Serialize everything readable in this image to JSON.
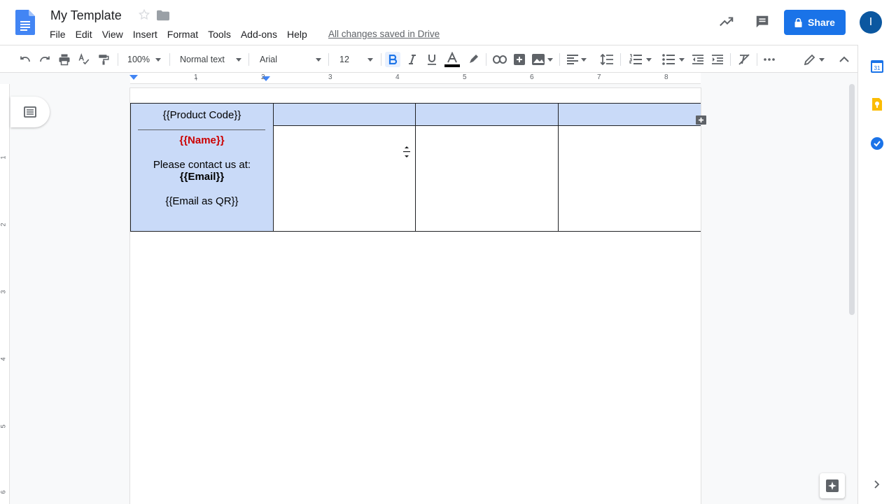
{
  "header": {
    "title": "My Template",
    "menu": [
      "File",
      "Edit",
      "View",
      "Insert",
      "Format",
      "Tools",
      "Add-ons",
      "Help"
    ],
    "save_status": "All changes saved in Drive",
    "share_label": "Share",
    "avatar_initial": "I"
  },
  "toolbar": {
    "zoom": "100%",
    "style": "Normal text",
    "font": "Arial",
    "size": "12"
  },
  "ruler": {
    "h_numbers": [
      "1",
      "2",
      "3",
      "4",
      "5",
      "6",
      "7",
      "8"
    ],
    "v_numbers": [
      "1",
      "2",
      "3",
      "4",
      "5",
      "6"
    ]
  },
  "document": {
    "cell": {
      "product_code": "{{Product Code}}",
      "name": "{{Name}}",
      "contact": "Please contact us at:",
      "email": "{{Email}}",
      "email_qr": "{{Email as QR}}"
    }
  },
  "icons": {
    "doc_logo": "docs-logo",
    "star": "star-icon",
    "folder": "folder-icon",
    "trend": "activity-trend-icon",
    "comment": "comment-icon",
    "lock": "lock-icon",
    "calendar": "calendar-icon",
    "keep": "keep-icon",
    "tasks": "tasks-icon"
  },
  "colors": {
    "accent": "#1a73e8",
    "cell_fill": "#c9daf8",
    "name_text": "#cc0000"
  }
}
